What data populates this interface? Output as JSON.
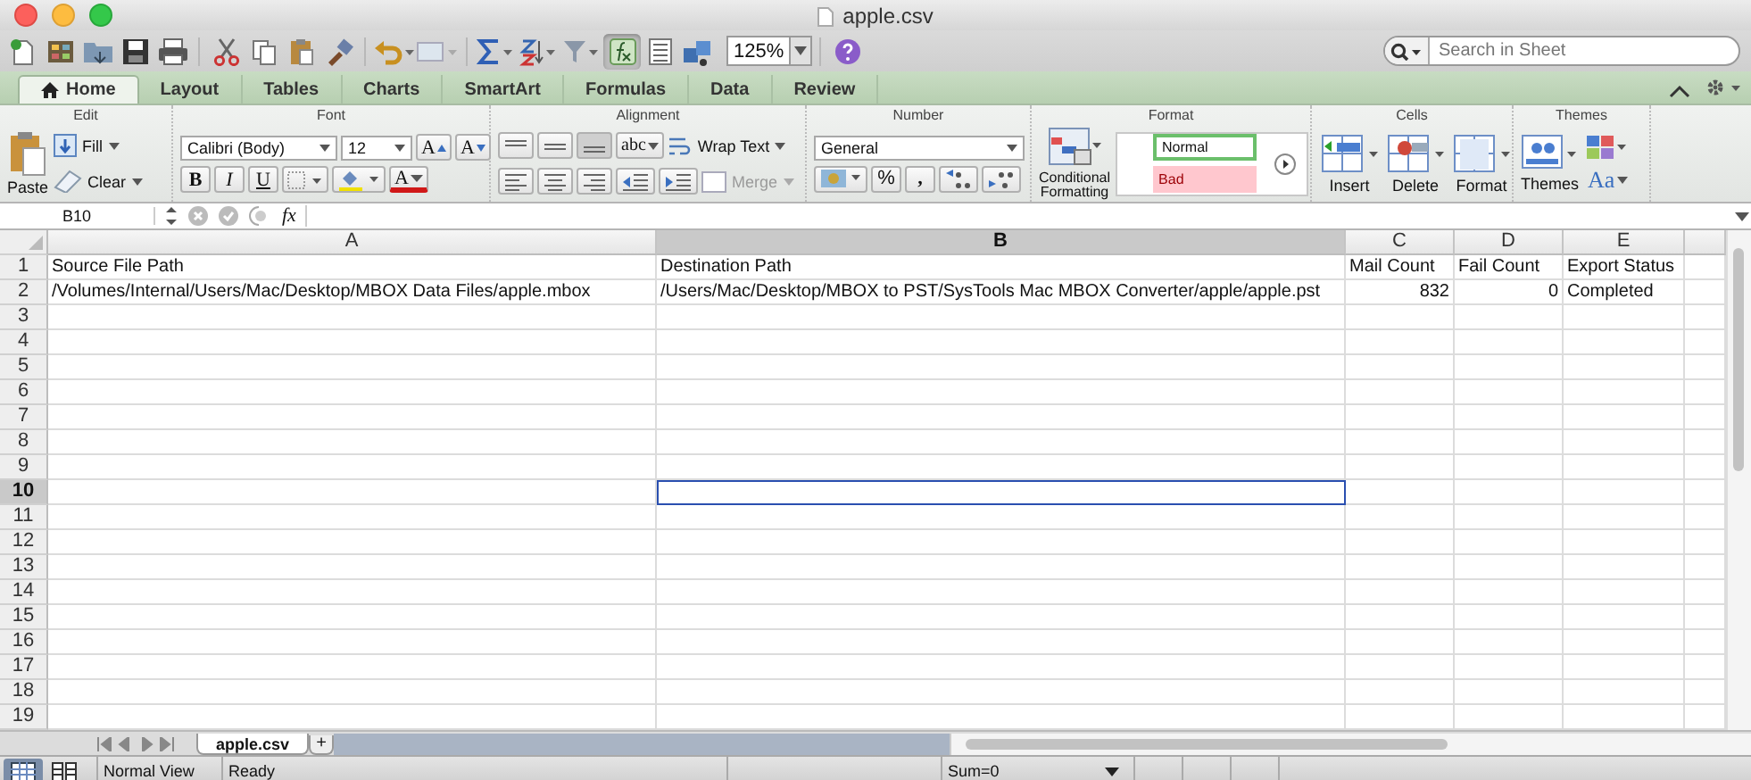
{
  "window": {
    "title": "apple.csv"
  },
  "toolbar": {
    "zoom": "125%",
    "search": {
      "placeholder": "Search in Sheet"
    }
  },
  "ribbon_tabs": [
    {
      "label": "Home",
      "selected": true
    },
    {
      "label": "Layout",
      "selected": false
    },
    {
      "label": "Tables",
      "selected": false
    },
    {
      "label": "Charts",
      "selected": false
    },
    {
      "label": "SmartArt",
      "selected": false
    },
    {
      "label": "Formulas",
      "selected": false
    },
    {
      "label": "Data",
      "selected": false
    },
    {
      "label": "Review",
      "selected": false
    }
  ],
  "ribbon": {
    "groups": [
      "Edit",
      "Font",
      "Alignment",
      "Number",
      "Format",
      "Cells",
      "Themes"
    ],
    "edit": {
      "paste": "Paste",
      "fill": "Fill",
      "clear": "Clear"
    },
    "font": {
      "name": "Calibri (Body)",
      "size": "12",
      "grow": "A",
      "shrink": "A",
      "bold": "B",
      "italic": "I",
      "underline": "U",
      "font_color_label": "A"
    },
    "alignment": {
      "orientation": "abc",
      "wrap": "Wrap Text",
      "merge": {
        "label": "Merge",
        "disabled": true
      }
    },
    "number": {
      "format": "General",
      "percent": "%",
      "comma": ","
    },
    "format": {
      "conditional": "Conditional Formatting",
      "styles": [
        {
          "label": "Normal",
          "kind": "normal"
        },
        {
          "label": "Bad",
          "kind": "bad"
        }
      ]
    },
    "cells": [
      "Insert",
      "Delete",
      "Format"
    ],
    "themes": {
      "themes": "Themes",
      "fonts": "Aa"
    }
  },
  "formula_bar": {
    "name_box": "B10",
    "fx": "fx"
  },
  "columns": [
    {
      "label": "A",
      "selected": false
    },
    {
      "label": "B",
      "selected": true
    },
    {
      "label": "C",
      "selected": false
    },
    {
      "label": "D",
      "selected": false
    },
    {
      "label": "E",
      "selected": false
    }
  ],
  "rows": [
    {
      "number": "1",
      "selected": false,
      "cells": [
        {
          "text": "Source File Path",
          "kind": "text"
        },
        {
          "text": "Destination Path",
          "kind": "text"
        },
        {
          "text": "Mail Count",
          "kind": "text"
        },
        {
          "text": "Fail Count",
          "kind": "text"
        },
        {
          "text": "Export Status",
          "kind": "text"
        }
      ]
    },
    {
      "number": "2",
      "selected": false,
      "cells": [
        {
          "text": "/Volumes/Internal/Users/Mac/Desktop/MBOX Data Files/apple.mbox",
          "kind": "text"
        },
        {
          "text": "/Users/Mac/Desktop/MBOX to PST/SysTools Mac MBOX Converter/apple/apple.pst",
          "kind": "text"
        },
        {
          "text": "832",
          "kind": "number"
        },
        {
          "text": "0",
          "kind": "number"
        },
        {
          "text": "Completed",
          "kind": "text"
        }
      ]
    },
    {
      "number": "3",
      "selected": false
    },
    {
      "number": "4",
      "selected": false
    },
    {
      "number": "5",
      "selected": false
    },
    {
      "number": "6",
      "selected": false
    },
    {
      "number": "7",
      "selected": false
    },
    {
      "number": "8",
      "selected": false
    },
    {
      "number": "9",
      "selected": false
    },
    {
      "number": "10",
      "selected": true
    },
    {
      "number": "11",
      "selected": false
    },
    {
      "number": "12",
      "selected": false
    },
    {
      "number": "13",
      "selected": false
    },
    {
      "number": "14",
      "selected": false
    },
    {
      "number": "15",
      "selected": false
    },
    {
      "number": "16",
      "selected": false
    },
    {
      "number": "17",
      "selected": false
    },
    {
      "number": "18",
      "selected": false
    },
    {
      "number": "19",
      "selected": false
    }
  ],
  "sheet_tabs": [
    {
      "label": "apple.csv",
      "selected": true
    }
  ],
  "add_sheet": "+",
  "status_bar": {
    "views": [
      {
        "kind": "normal",
        "selected": true
      },
      {
        "kind": "layout",
        "selected": false
      }
    ],
    "view_name": "Normal View",
    "state": "Ready",
    "sum": "Sum=0"
  }
}
